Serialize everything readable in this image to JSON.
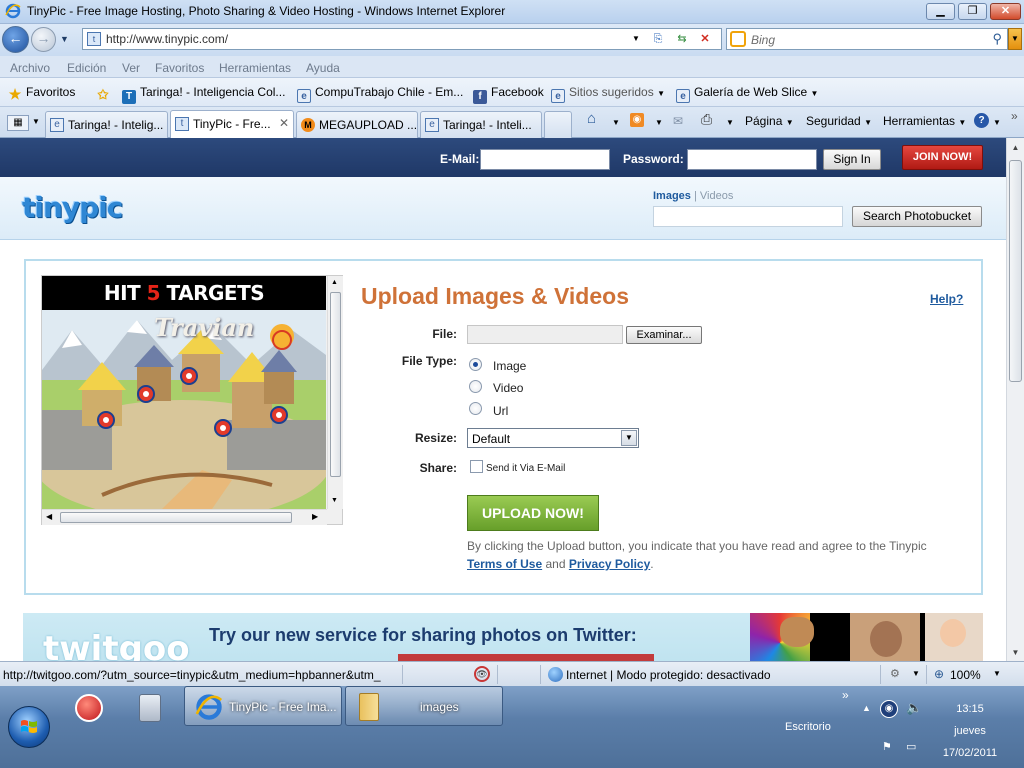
{
  "window": {
    "title": "TinyPic - Free Image Hosting, Photo Sharing & Video Hosting - Windows Internet Explorer"
  },
  "address": {
    "url": "http://www.tinypic.com/",
    "search_placeholder": "Bing"
  },
  "menubar": [
    "Archivo",
    "Edición",
    "Ver",
    "Favoritos",
    "Herramientas",
    "Ayuda"
  ],
  "favorites": {
    "label": "Favoritos",
    "items": [
      "Taringa! - Inteligencia Col...",
      "CompuTrabajo Chile - Em...",
      "Facebook",
      "Sitios sugeridos",
      "Galería de Web Slice"
    ]
  },
  "tabs": [
    {
      "label": "Taringa! - Intelig..."
    },
    {
      "label": "TinyPic - Fre...",
      "active": true
    },
    {
      "label": "MEGAUPLOAD ..."
    },
    {
      "label": "Taringa! - Inteli..."
    }
  ],
  "commandbar": {
    "page": "Página",
    "safety": "Seguridad",
    "tools": "Herramientas"
  },
  "tinypic": {
    "email_label": "E-Mail:",
    "password_label": "Password:",
    "signin": "Sign In",
    "join": "JOIN NOW!",
    "logo": "tinypic",
    "search_tab_images": "Images",
    "search_tab_sep": "|",
    "search_tab_videos": "Videos",
    "search_button": "Search Photobucket"
  },
  "ad": {
    "headline_pre": "HIT ",
    "headline_num": "5",
    "headline_post": " TARGETS",
    "game_title": "Travian"
  },
  "upload": {
    "title": "Upload Images & Videos",
    "help": "Help?",
    "file_label": "File:",
    "browse": "Examinar...",
    "filetype_label": "File Type:",
    "types": [
      "Image",
      "Video",
      "Url"
    ],
    "selected_type": "Image",
    "resize_label": "Resize:",
    "resize_value": "Default",
    "share_label": "Share:",
    "share_option": "Send it Via E-Mail",
    "upload_button": "UPLOAD NOW!",
    "disclaimer_pre": "By clicking the Upload button, you indicate that you have read and agree to the Tinypic",
    "terms": "Terms of Use",
    "and": "and",
    "privacy": "Privacy Policy",
    "period": "."
  },
  "banner": {
    "logo": "twitgoo",
    "text": "Try our new service for sharing photos on Twitter:"
  },
  "statusbar": {
    "url": "http://twitgoo.com/?utm_source=tinypic&utm_medium=hpbanner&utm_",
    "zone": "Internet | Modo protegido: desactivado",
    "zoom": "100%"
  },
  "taskbar": {
    "tasks": [
      "TinyPic - Free Ima...",
      "images"
    ],
    "desktop": "Escritorio",
    "time": "13:15",
    "day": "jueves",
    "date": "17/02/2011"
  },
  "colors": {
    "tinypic_topbar": "#2d4a7d",
    "upload_title": "#cf7238",
    "upload_button": "#7fb53f",
    "join_button": "#c8261f",
    "link": "#1e5a9e"
  }
}
